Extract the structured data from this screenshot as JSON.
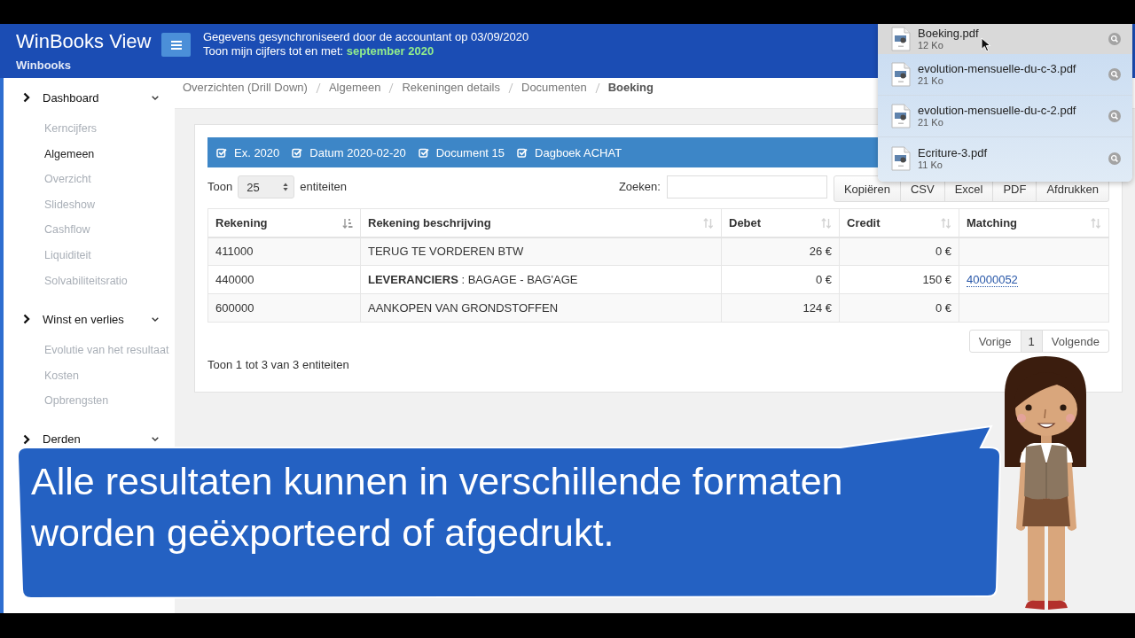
{
  "header": {
    "app_title": "WinBooks View",
    "company": "Winbooks",
    "sync_text": "Gegevens gesynchroniseerd door de accountant op 03/09/2020",
    "period_text": "Toon mijn cijfers tot en met: **september 2020**"
  },
  "sidebar": {
    "sections": [
      {
        "label": "Dashboard",
        "items": [
          {
            "label": "Kerncijfers",
            "selected": false
          },
          {
            "label": "Algemeen",
            "selected": true
          },
          {
            "label": "Overzicht",
            "selected": false
          },
          {
            "label": "Slideshow",
            "selected": false
          },
          {
            "label": "Cashflow",
            "selected": false
          },
          {
            "label": "Liquiditeit",
            "selected": false
          },
          {
            "label": "Solvabiliteitsratio",
            "selected": false
          }
        ]
      },
      {
        "label": "Winst en verlies",
        "items": [
          {
            "label": "Evolutie van het resultaat",
            "selected": false
          },
          {
            "label": "Kosten",
            "selected": false
          },
          {
            "label": "Opbrengsten",
            "selected": false
          }
        ]
      },
      {
        "label": "Derden"
      }
    ]
  },
  "breadcrumb": [
    {
      "label": "Overzichten (Drill Down)",
      "current": false
    },
    {
      "label": "Algemeen",
      "current": false
    },
    {
      "label": "Rekeningen details",
      "current": false
    },
    {
      "label": "Documenten",
      "current": false
    },
    {
      "label": "Boeking",
      "current": true
    }
  ],
  "filters": [
    {
      "label": "Ex. 2020",
      "checked": true
    },
    {
      "label": "Datum 2020-02-20",
      "checked": true
    },
    {
      "label": "Document 15",
      "checked": true
    },
    {
      "label": "Dagboek ACHAT",
      "checked": true
    }
  ],
  "length_control": {
    "label_before": "Toon",
    "value": "25",
    "label_after": "entiteiten"
  },
  "search": {
    "label": "Zoeken:"
  },
  "export_buttons": [
    "Kopiëren",
    "CSV",
    "Excel",
    "PDF",
    "Afdrukken"
  ],
  "table": {
    "columns": [
      {
        "label": "Rekening",
        "kind": "text",
        "sorted": true
      },
      {
        "label": "Rekening beschrijving",
        "kind": "text",
        "sorted": false
      },
      {
        "label": "Debet",
        "kind": "amount",
        "sorted": false
      },
      {
        "label": "Credit",
        "kind": "amount",
        "sorted": false
      },
      {
        "label": "Matching",
        "kind": "link",
        "sorted": false
      }
    ],
    "rows": [
      {
        "cells": [
          "411000",
          "TERUG TE VORDEREN BTW",
          "26 €",
          "0 €"
        ]
      },
      {
        "cells": [
          "440000",
          "**LEVERANCIERS** : BAGAGE - BAG'AGE",
          "0 €",
          "150 €",
          "40000052"
        ]
      },
      {
        "cells": [
          "600000",
          "AANKOPEN VAN GRONDSTOFFEN",
          "124 €",
          "0 €"
        ]
      }
    ]
  },
  "pagination": {
    "previous": "Vorige",
    "pages": [
      {
        "label": "1",
        "selected": true
      }
    ],
    "next": "Volgende"
  },
  "info": "Toon 1 tot 3 van 3 entiteiten",
  "downloads": [
    {
      "name": "Boeking.pdf",
      "size": "12 Ko",
      "hovered": true
    },
    {
      "name": "evolution-mensuelle-du-c-3.pdf",
      "size": "21 Ko",
      "hovered": false
    },
    {
      "name": "evolution-mensuelle-du-c-2.pdf",
      "size": "21 Ko",
      "hovered": false
    },
    {
      "name": "Ecriture-3.pdf",
      "size": "11 Ko",
      "hovered": false
    }
  ],
  "caption": "Alle resultaten kunnen in verschillende formaten worden geëxporteerd of afgedrukt."
}
